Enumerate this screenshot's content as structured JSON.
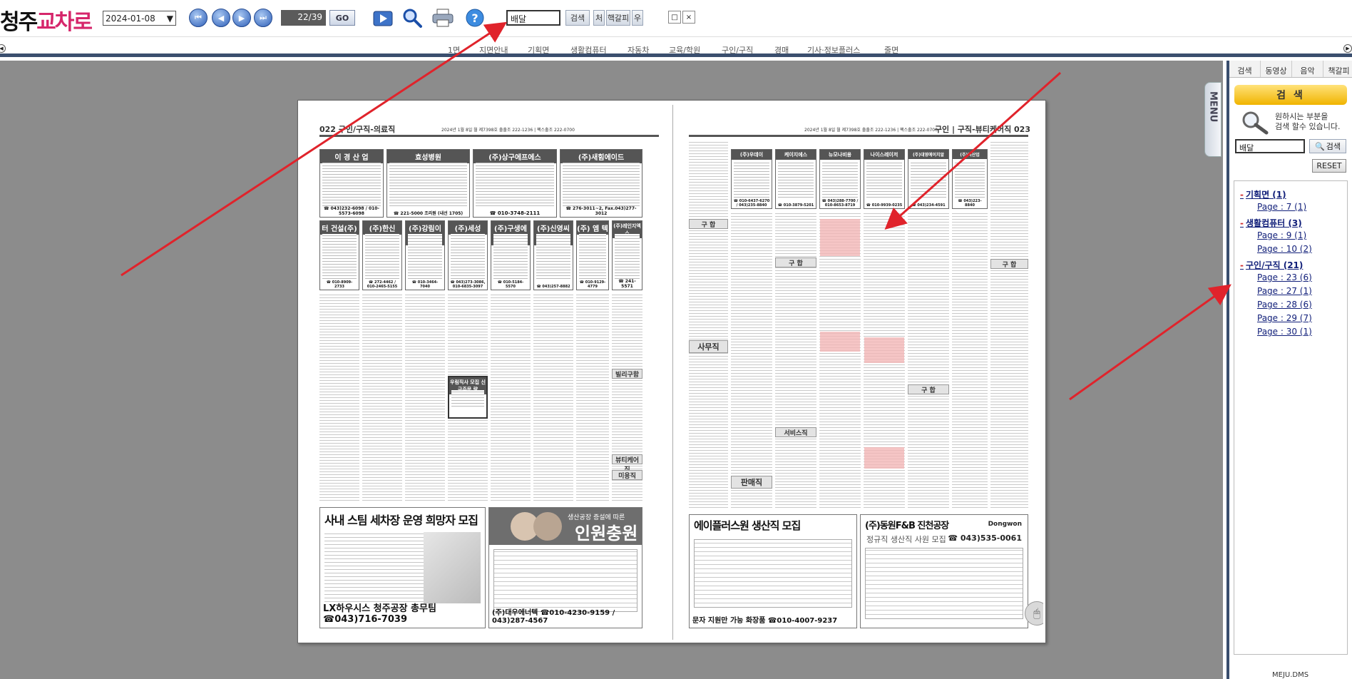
{
  "logo": {
    "part1": "청주",
    "part2": "교차로"
  },
  "toolbar": {
    "date": "2024-01-08",
    "page_indicator": "22/39",
    "go_label": "GO",
    "search_value": "배달",
    "search_btn": "검색",
    "btn_first": "처",
    "btn_middle": "핵갈피",
    "btn_last": "우",
    "restore_label": "□",
    "close_label": "×"
  },
  "menu": {
    "items": [
      "1면",
      "지면안내",
      "기획면",
      "생활컴퓨터",
      "자동차",
      "교육/학원",
      "구인/구직",
      "경매",
      "기사·정보플러스",
      "줄면"
    ]
  },
  "newspaper": {
    "left_header": "022 구인/구직-의료직",
    "left_header_mid": "2024년 1월 8일 월 제7398호  출출조 222-1236 | 팩스출조 222-0700",
    "right_header": "구인 | 구직-뷰티케어직 023",
    "right_header_mid": "2024년 1월 8일 월 제7398호  출출조 222-1236 | 팩스출조 222-0700",
    "left_boxes": [
      {
        "title": "이 경 산 업",
        "phone": "☎ 043)232-6098 / 010-5573-6098"
      },
      {
        "title": "효성병원",
        "phone": "☎ 221-5000 조리원 (내선 1705)"
      },
      {
        "title": "(주)상구에프에스",
        "phone": "☎ 010-3748-2111"
      },
      {
        "title": "(주)새힘에이드",
        "phone": "☎ 276-3011~2, Fax.043)277-3012"
      },
      {
        "title": "터 건설(주)",
        "phone": "☎ 010-8909-2733"
      },
      {
        "title": "(주)한신",
        "phone": "☎ 272-4462 / 010-2465-5155"
      },
      {
        "title": "(주)강림이엔알",
        "phone": "☎ 010-3464-7040"
      },
      {
        "title": "(주)세성",
        "phone": "☎ 043)273-3086, 010-6835-3097"
      },
      {
        "title": "(주)구생에스",
        "phone": "☎ 010-5184-5570"
      },
      {
        "title": "(주)신영씨스템",
        "phone": "☎ 043)257-8882"
      },
      {
        "title": "(주) 엠 텍",
        "phone": "☎ 010-9129-4779"
      },
      {
        "title": "(주)레인지엑스",
        "phone": "☎ 241-5571"
      }
    ],
    "right_boxes": [
      {
        "title": "(주)우데이",
        "phone": "☎ 010-6437-6270 / 043)235-8840"
      },
      {
        "title": "케이지에스",
        "phone": "☎ 010-3879-5201"
      },
      {
        "title": "뉴모나비용",
        "phone": "☎ 043)288-7700 / 010-8653-8719"
      },
      {
        "title": "나이스레이저",
        "phone": "☎ 010-9939-0235"
      },
      {
        "title": "(주)대영에이치알",
        "phone": "☎ 043)234-4591"
      },
      {
        "title": "(주)리산업",
        "phone": "☎ 043)223-8840"
      }
    ],
    "section_labels": [
      "구 합",
      "사무직",
      "판매직",
      "서비스직",
      "뷰티케어직",
      "미용직",
      "빌리구함"
    ],
    "ad1_title": "사내 스팀 세차장 운영 희망자 모집",
    "ad1_footer": "LX하우시스 청주공장 총무팀 ☎043)716-7039",
    "ad2_title": "인원충원",
    "ad2_sub": "생산공장 증설에 따른",
    "ad2_footer": "(주)대우에너텍 ☎010-4230-9159 / 043)287-4567",
    "ad3_title": "에이플러스원  생산직 모집",
    "ad3_footer": "문자 지원만 가능  화장품 ☎010-4007-9237",
    "ad4_title": "(주)동원F&B 진천공장",
    "ad4_sub": "정규직 생산직 사원 모집",
    "ad4_phone": "☎ 043)535-0061",
    "ad4_brand": "Dongwon",
    "small_ad_title": "우림직사 모집 신규주문 량"
  },
  "menu_tab": "MENU",
  "sidebar": {
    "tabs": [
      "검색",
      "동영상",
      "음악",
      "책갈피"
    ],
    "title": "검 색",
    "hint": "원하시는 부분을\n검색 할수 있습니다.",
    "input_value": "배달",
    "search_btn": "검색",
    "reset_btn": "RESET",
    "results": [
      {
        "group": "기획면 (1)",
        "pages": [
          "Page : 7 (1)"
        ]
      },
      {
        "group": "생활컴퓨터 (3)",
        "pages": [
          "Page : 9 (1)",
          "Page : 10 (2)"
        ]
      },
      {
        "group": "구인/구직 (21)",
        "pages": [
          "Page : 23 (6)",
          "Page : 27 (1)",
          "Page : 28 (6)",
          "Page : 29 (7)",
          "Page : 30 (1)"
        ]
      }
    ],
    "footer": "MEJU.DMS"
  },
  "colors": {
    "logo_accent": "#d6266b",
    "frame": "#3a4e6e",
    "viewer_bg": "#8c8c8c",
    "arrow": "#e0232b",
    "result_link": "#12207a"
  }
}
